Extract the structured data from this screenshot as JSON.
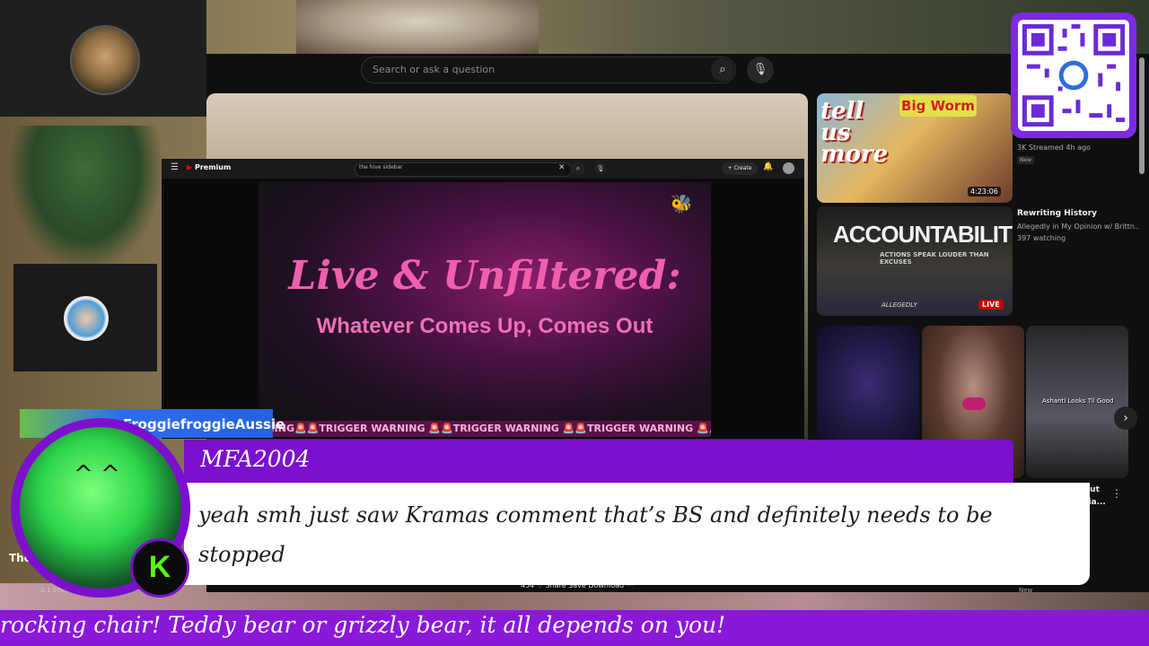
{
  "youtube": {
    "search_placeholder": "Search or ask a question",
    "search_icon": "search-icon",
    "mic_icon": "mic-icon"
  },
  "inner_window": {
    "logo": "Premium",
    "search_text": "the hive sidebar",
    "create_label": "+ Create"
  },
  "stream_art": {
    "title": "Live & Unfiltered:",
    "subtitle": "Whatever Comes Up, Comes Out",
    "marquee": "RNING🚨🚨TRIGGER WARNING 🚨🚨TRIGGER WARNING 🚨🚨TRIGGER WARNING 🚨🚨TRI"
  },
  "recommended": [
    {
      "thumb_text_1": "tell us more",
      "thumb_text_2": "Big Worm",
      "duration": "4:23:06",
      "stats": "3K  Streamed 4h ago",
      "badge": "New"
    },
    {
      "thumb_text_1": "ACCOUNTABILITY",
      "thumb_text_2": "ACTIONS SPEAK LOUDER THAN EXCUSES",
      "thumb_text_3": "ALLEGEDLY",
      "live_label": "LIVE",
      "title": "Rewriting History",
      "channel": "Allegedly in My Opinion w/ Brittn...",
      "watching": "397 watching"
    },
    {
      "caption": "Ashanti Looks Til Good"
    }
  ],
  "short_titles": {
    "line1": "out",
    "line2": "ria..."
  },
  "chat": {
    "streamer": "FroggiefroggieAussie",
    "username": "MFA2004",
    "message": "yeah smh just saw Kramas comment that’s BS and definitely needs to be stopped",
    "platform_logo": "K"
  },
  "underlay": {
    "title": "The",
    "sub": "A   1.57K s",
    "actions": "454      ♢      Share        Save        Download        ···",
    "new_badge": "New"
  },
  "ticker": {
    "text": "rocking chair! Teddy bear or grizzly bear, it all depends on you!"
  },
  "colors": {
    "accent_purple": "#7b11cc",
    "kick_green": "#53fc18",
    "youtube_red": "#ff0000",
    "art_pink": "#f05fae"
  }
}
